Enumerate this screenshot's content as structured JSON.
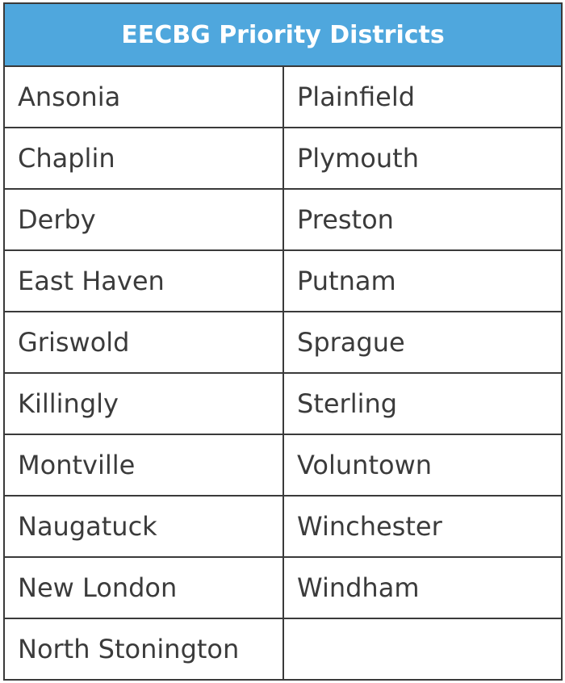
{
  "title": "EECBG Priority Districts",
  "colors": {
    "header_bg": "#4fa7dd",
    "header_text": "#ffffff",
    "text": "#3b3b3b",
    "border": "#3a3a3a"
  },
  "rows": [
    [
      "Ansonia",
      "Plainfield"
    ],
    [
      "Chaplin",
      "Plymouth"
    ],
    [
      "Derby",
      "Preston"
    ],
    [
      "East Haven",
      "Putnam"
    ],
    [
      "Griswold",
      "Sprague"
    ],
    [
      "Killingly",
      "Sterling"
    ],
    [
      "Montville",
      "Voluntown"
    ],
    [
      "Naugatuck",
      "Winchester"
    ],
    [
      "New London",
      "Windham"
    ],
    [
      "North Stonington",
      ""
    ]
  ]
}
